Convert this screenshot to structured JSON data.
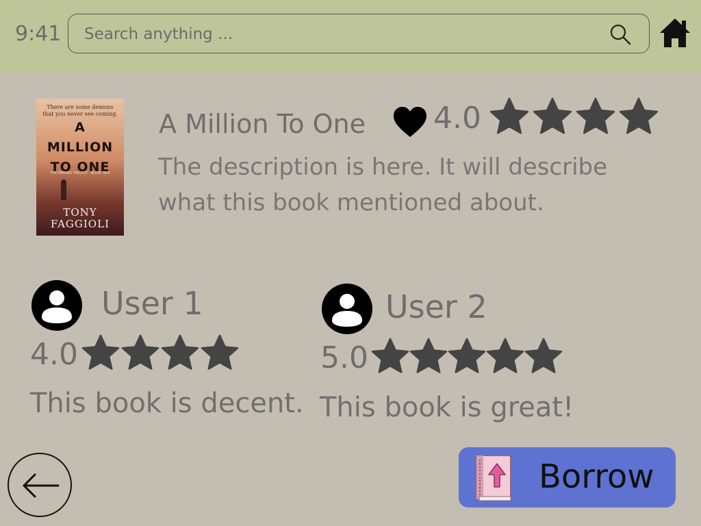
{
  "status_bar": {
    "time": "9:41"
  },
  "search": {
    "placeholder": "Search anything ..."
  },
  "book": {
    "cover": {
      "tagline": "There are some demons that you never see coming.",
      "title_line1": "A",
      "title_line2": "MILLION",
      "title_line3": "TO ONE",
      "series": "THE FARANO TRILOGY · BOOK TWO",
      "author_line1": "TONY",
      "author_line2": "FAGGIOLI"
    },
    "title": "A Million To One",
    "rating": "4.0",
    "rating_stars": 4,
    "description": "The description is here. It will describe what this book mentioned about."
  },
  "reviews": [
    {
      "user": "User 1",
      "rating": "4.0",
      "rating_stars": 4,
      "text": "This book is decent."
    },
    {
      "user": "User 2",
      "rating": "5.0",
      "rating_stars": 5,
      "text": "This book is great!"
    }
  ],
  "actions": {
    "borrow_label": "Borrow"
  },
  "icons": {
    "search": "search-icon",
    "home": "home-icon",
    "favorite": "heart-icon",
    "star": "star-icon",
    "avatar": "user-avatar-icon",
    "back": "arrow-left-icon",
    "borrow": "book-upload-icon"
  },
  "colors": {
    "background": "#c4bdb1",
    "topbar": "#bec699",
    "star": "#444444",
    "borrow_button": "#5e72d2"
  }
}
